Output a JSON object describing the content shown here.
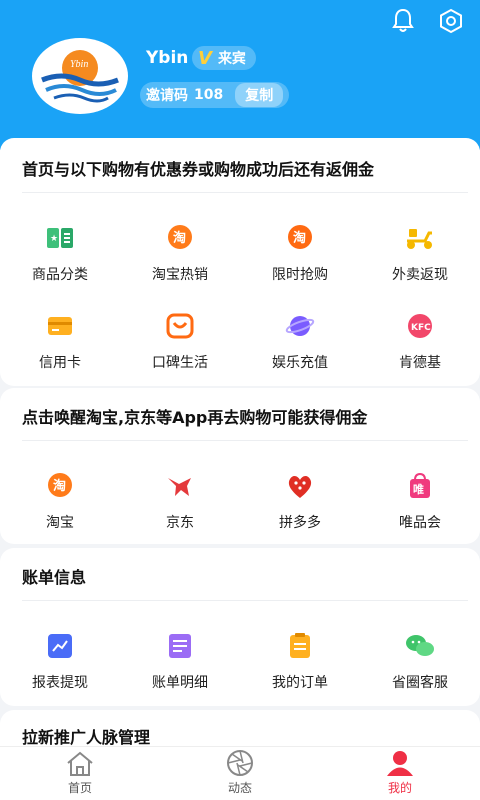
{
  "header": {
    "username": "Ybin",
    "vip_mark": "V",
    "vip_label": "来宾",
    "invite_label": "邀请码",
    "invite_code": "108",
    "copy_label": "复制",
    "logo_text": "Ybin",
    "bg_color": "#1aa3f6"
  },
  "sections": [
    {
      "title": "首页与以下购物有优惠券或购物成功后还有返佣金",
      "items": [
        {
          "label": "商品分类",
          "icon": "category-book-icon"
        },
        {
          "label": "淘宝热销",
          "icon": "taobao-icon"
        },
        {
          "label": "限时抢购",
          "icon": "taobao-icon"
        },
        {
          "label": "外卖返现",
          "icon": "scooter-icon"
        },
        {
          "label": "信用卡",
          "icon": "credit-card-icon"
        },
        {
          "label": "口碑生活",
          "icon": "koubei-icon"
        },
        {
          "label": "娱乐充值",
          "icon": "planet-icon"
        },
        {
          "label": "肯德基",
          "icon": "kfc-icon"
        }
      ]
    },
    {
      "title": "点击唤醒淘宝,京东等App再去购物可能获得佣金",
      "items": [
        {
          "label": "淘宝",
          "icon": "taobao-icon"
        },
        {
          "label": "京东",
          "icon": "jd-dog-icon"
        },
        {
          "label": "拼多多",
          "icon": "pinduoduo-icon"
        },
        {
          "label": "唯品会",
          "icon": "vip-bag-icon"
        }
      ]
    },
    {
      "title": "账单信息",
      "items": [
        {
          "label": "报表提现",
          "icon": "chart-icon"
        },
        {
          "label": "账单明细",
          "icon": "bill-icon"
        },
        {
          "label": "我的订单",
          "icon": "order-icon"
        },
        {
          "label": "省圈客服",
          "icon": "wechat-icon"
        }
      ]
    },
    {
      "title": "拉新推广人脉管理",
      "items": []
    }
  ],
  "tabbar": [
    {
      "label": "首页",
      "icon": "home-icon",
      "active": false
    },
    {
      "label": "动态",
      "icon": "aperture-icon",
      "active": false
    },
    {
      "label": "我的",
      "icon": "user-icon",
      "active": true
    }
  ],
  "colors": {
    "accent": "#1aa3f6",
    "active_tab": "#ef2f45"
  },
  "kfc_text": "KFC",
  "taobao_glyph": "淘",
  "vip_glyph": "唯"
}
